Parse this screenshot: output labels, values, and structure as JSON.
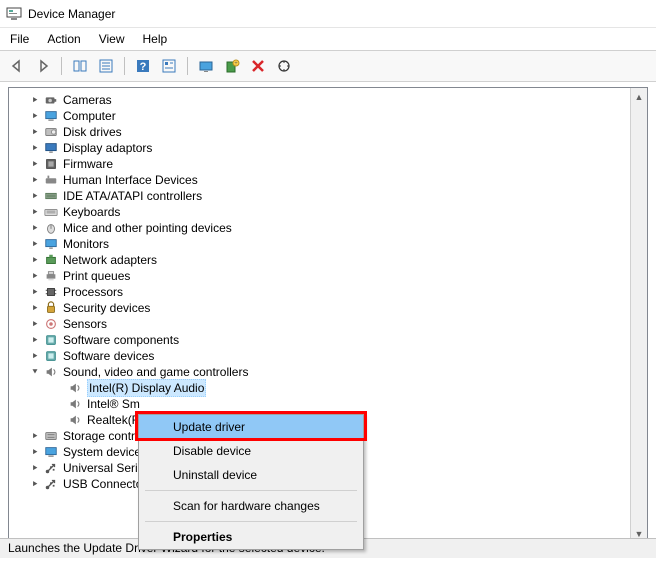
{
  "window": {
    "title": "Device Manager"
  },
  "menubar": {
    "file": "File",
    "action": "Action",
    "view": "View",
    "help": "Help"
  },
  "toolbar_icons": {
    "back": "back-arrow",
    "forward": "forward-arrow",
    "show_hidden": "show-hidden",
    "properties_sheet": "properties-sheet",
    "help": "help",
    "properties": "properties",
    "monitor": "monitor",
    "update": "update-driver",
    "delete": "delete",
    "scan": "scan-hardware"
  },
  "tree": {
    "categories": [
      {
        "label": "Cameras",
        "icon": "camera"
      },
      {
        "label": "Computer",
        "icon": "computer"
      },
      {
        "label": "Disk drives",
        "icon": "disk"
      },
      {
        "label": "Display adaptors",
        "icon": "display"
      },
      {
        "label": "Firmware",
        "icon": "firmware"
      },
      {
        "label": "Human Interface Devices",
        "icon": "hid"
      },
      {
        "label": "IDE ATA/ATAPI controllers",
        "icon": "ide"
      },
      {
        "label": "Keyboards",
        "icon": "keyboard"
      },
      {
        "label": "Mice and other pointing devices",
        "icon": "mouse"
      },
      {
        "label": "Monitors",
        "icon": "monitor"
      },
      {
        "label": "Network adapters",
        "icon": "network"
      },
      {
        "label": "Print queues",
        "icon": "printer"
      },
      {
        "label": "Processors",
        "icon": "cpu"
      },
      {
        "label": "Security devices",
        "icon": "security"
      },
      {
        "label": "Sensors",
        "icon": "sensor"
      },
      {
        "label": "Software components",
        "icon": "software"
      },
      {
        "label": "Software devices",
        "icon": "software"
      },
      {
        "label": "Sound, video and game controllers",
        "icon": "sound",
        "expanded": true,
        "children": [
          {
            "label": "Intel(R) Display Audio",
            "icon": "sound",
            "selected": true
          },
          {
            "label": "Intel® Sm",
            "icon": "sound"
          },
          {
            "label": "Realtek(R)",
            "icon": "sound"
          }
        ]
      },
      {
        "label": "Storage contr",
        "icon": "storage"
      },
      {
        "label": "System device",
        "icon": "system"
      },
      {
        "label": "Universal Seri",
        "icon": "usb"
      },
      {
        "label": "USB Connecto",
        "icon": "usb"
      }
    ]
  },
  "context_menu": {
    "update": "Update driver",
    "disable": "Disable device",
    "uninstall": "Uninstall device",
    "scan": "Scan for hardware changes",
    "properties": "Properties"
  },
  "statusbar": {
    "text": "Launches the Update Driver Wizard for the selected device."
  }
}
